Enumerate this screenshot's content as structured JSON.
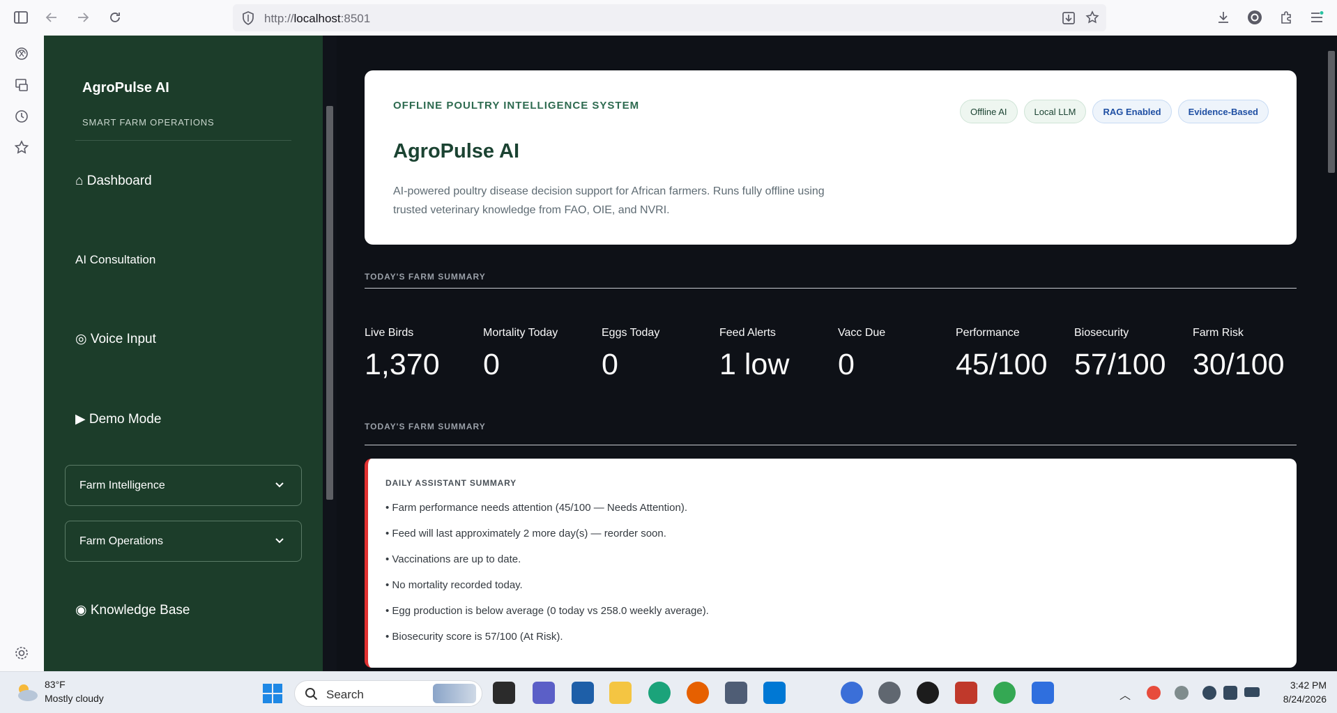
{
  "browser": {
    "url_prefix": "http://",
    "url_host": "localhost",
    "url_port": ":8501"
  },
  "sidebar": {
    "brand": "AgroPulse AI",
    "brand_sub": "SMART FARM OPERATIONS",
    "nav": [
      {
        "label": "⌂ Dashboard"
      },
      {
        "label": "AI Consultation"
      },
      {
        "label": "◎ Voice Input"
      },
      {
        "label": "▶ Demo Mode"
      },
      {
        "label": "◉ Knowledge Base"
      }
    ],
    "expanders": [
      {
        "label": "Farm Intelligence"
      },
      {
        "label": "Farm Operations"
      }
    ]
  },
  "hero": {
    "eyebrow": "OFFLINE POULTRY INTELLIGENCE SYSTEM",
    "title": "AgroPulse AI",
    "description": "AI-powered poultry disease decision support for African farmers. Runs fully offline using trusted veterinary knowledge from FAO, OIE, and NVRI.",
    "badges": [
      {
        "label": "Offline AI",
        "style": "green"
      },
      {
        "label": "Local LLM",
        "style": "green"
      },
      {
        "label": "RAG Enabled",
        "style": "blue"
      },
      {
        "label": "Evidence-Based",
        "style": "blue"
      }
    ]
  },
  "sections": {
    "summary_label_1": "TODAY'S FARM SUMMARY",
    "summary_label_2": "TODAY'S FARM SUMMARY"
  },
  "metrics": [
    {
      "label": "Live Birds",
      "value": "1,370"
    },
    {
      "label": "Mortality Today",
      "value": "0"
    },
    {
      "label": "Eggs Today",
      "value": "0"
    },
    {
      "label": "Feed Alerts",
      "value": "1 low"
    },
    {
      "label": "Vacc Due",
      "value": "0"
    },
    {
      "label": "Performance",
      "value": "45/100"
    },
    {
      "label": "Biosecurity",
      "value": "57/100"
    },
    {
      "label": "Farm Risk",
      "value": "30/100"
    }
  ],
  "assistant": {
    "title": "DAILY ASSISTANT SUMMARY",
    "items": [
      "• Farm performance needs attention (45/100 — Needs Attention).",
      "• Feed will last approximately 2 more day(s) — reorder soon.",
      "• Vaccinations are up to date.",
      "• No mortality recorded today.",
      "• Egg production is below average (0 today vs 258.0 weekly average).",
      "• Biosecurity score is 57/100 (At Risk)."
    ]
  },
  "taskbar": {
    "weather_temp": "83°F",
    "weather_desc": "Mostly cloudy",
    "search_label": "Search",
    "time": "3:42 PM",
    "date": "8/24/2026"
  },
  "colors": {
    "sidebar_bg": "#1c3d2a",
    "app_bg": "#0e1117",
    "accent_green": "#2d6a4f",
    "alert_red": "#e03131"
  }
}
